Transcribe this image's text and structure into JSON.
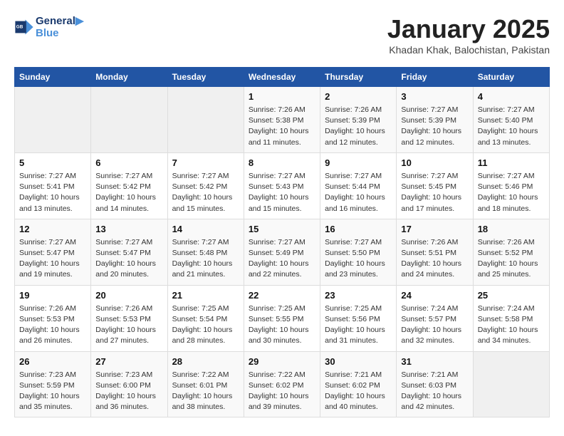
{
  "header": {
    "logo_line1": "General",
    "logo_line2": "Blue",
    "month": "January 2025",
    "location": "Khadan Khak, Balochistan, Pakistan"
  },
  "days_of_week": [
    "Sunday",
    "Monday",
    "Tuesday",
    "Wednesday",
    "Thursday",
    "Friday",
    "Saturday"
  ],
  "weeks": [
    [
      {
        "day": "",
        "empty": true
      },
      {
        "day": "",
        "empty": true
      },
      {
        "day": "",
        "empty": true
      },
      {
        "day": "1",
        "sunrise": "7:26 AM",
        "sunset": "5:38 PM",
        "daylight": "10 hours and 11 minutes."
      },
      {
        "day": "2",
        "sunrise": "7:26 AM",
        "sunset": "5:39 PM",
        "daylight": "10 hours and 12 minutes."
      },
      {
        "day": "3",
        "sunrise": "7:27 AM",
        "sunset": "5:39 PM",
        "daylight": "10 hours and 12 minutes."
      },
      {
        "day": "4",
        "sunrise": "7:27 AM",
        "sunset": "5:40 PM",
        "daylight": "10 hours and 13 minutes."
      }
    ],
    [
      {
        "day": "5",
        "sunrise": "7:27 AM",
        "sunset": "5:41 PM",
        "daylight": "10 hours and 13 minutes."
      },
      {
        "day": "6",
        "sunrise": "7:27 AM",
        "sunset": "5:42 PM",
        "daylight": "10 hours and 14 minutes."
      },
      {
        "day": "7",
        "sunrise": "7:27 AM",
        "sunset": "5:42 PM",
        "daylight": "10 hours and 15 minutes."
      },
      {
        "day": "8",
        "sunrise": "7:27 AM",
        "sunset": "5:43 PM",
        "daylight": "10 hours and 15 minutes."
      },
      {
        "day": "9",
        "sunrise": "7:27 AM",
        "sunset": "5:44 PM",
        "daylight": "10 hours and 16 minutes."
      },
      {
        "day": "10",
        "sunrise": "7:27 AM",
        "sunset": "5:45 PM",
        "daylight": "10 hours and 17 minutes."
      },
      {
        "day": "11",
        "sunrise": "7:27 AM",
        "sunset": "5:46 PM",
        "daylight": "10 hours and 18 minutes."
      }
    ],
    [
      {
        "day": "12",
        "sunrise": "7:27 AM",
        "sunset": "5:47 PM",
        "daylight": "10 hours and 19 minutes."
      },
      {
        "day": "13",
        "sunrise": "7:27 AM",
        "sunset": "5:47 PM",
        "daylight": "10 hours and 20 minutes."
      },
      {
        "day": "14",
        "sunrise": "7:27 AM",
        "sunset": "5:48 PM",
        "daylight": "10 hours and 21 minutes."
      },
      {
        "day": "15",
        "sunrise": "7:27 AM",
        "sunset": "5:49 PM",
        "daylight": "10 hours and 22 minutes."
      },
      {
        "day": "16",
        "sunrise": "7:27 AM",
        "sunset": "5:50 PM",
        "daylight": "10 hours and 23 minutes."
      },
      {
        "day": "17",
        "sunrise": "7:26 AM",
        "sunset": "5:51 PM",
        "daylight": "10 hours and 24 minutes."
      },
      {
        "day": "18",
        "sunrise": "7:26 AM",
        "sunset": "5:52 PM",
        "daylight": "10 hours and 25 minutes."
      }
    ],
    [
      {
        "day": "19",
        "sunrise": "7:26 AM",
        "sunset": "5:53 PM",
        "daylight": "10 hours and 26 minutes."
      },
      {
        "day": "20",
        "sunrise": "7:26 AM",
        "sunset": "5:53 PM",
        "daylight": "10 hours and 27 minutes."
      },
      {
        "day": "21",
        "sunrise": "7:25 AM",
        "sunset": "5:54 PM",
        "daylight": "10 hours and 28 minutes."
      },
      {
        "day": "22",
        "sunrise": "7:25 AM",
        "sunset": "5:55 PM",
        "daylight": "10 hours and 30 minutes."
      },
      {
        "day": "23",
        "sunrise": "7:25 AM",
        "sunset": "5:56 PM",
        "daylight": "10 hours and 31 minutes."
      },
      {
        "day": "24",
        "sunrise": "7:24 AM",
        "sunset": "5:57 PM",
        "daylight": "10 hours and 32 minutes."
      },
      {
        "day": "25",
        "sunrise": "7:24 AM",
        "sunset": "5:58 PM",
        "daylight": "10 hours and 34 minutes."
      }
    ],
    [
      {
        "day": "26",
        "sunrise": "7:23 AM",
        "sunset": "5:59 PM",
        "daylight": "10 hours and 35 minutes."
      },
      {
        "day": "27",
        "sunrise": "7:23 AM",
        "sunset": "6:00 PM",
        "daylight": "10 hours and 36 minutes."
      },
      {
        "day": "28",
        "sunrise": "7:22 AM",
        "sunset": "6:01 PM",
        "daylight": "10 hours and 38 minutes."
      },
      {
        "day": "29",
        "sunrise": "7:22 AM",
        "sunset": "6:02 PM",
        "daylight": "10 hours and 39 minutes."
      },
      {
        "day": "30",
        "sunrise": "7:21 AM",
        "sunset": "6:02 PM",
        "daylight": "10 hours and 40 minutes."
      },
      {
        "day": "31",
        "sunrise": "7:21 AM",
        "sunset": "6:03 PM",
        "daylight": "10 hours and 42 minutes."
      },
      {
        "day": "",
        "empty": true
      }
    ]
  ],
  "labels": {
    "sunrise": "Sunrise:",
    "sunset": "Sunset:",
    "daylight": "Daylight:"
  }
}
